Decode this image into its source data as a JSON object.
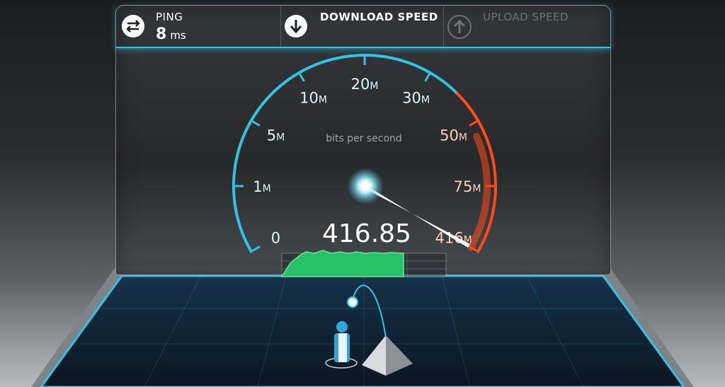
{
  "ping": {
    "label": "PING",
    "value": "8",
    "unit": "ms"
  },
  "download": {
    "label": "DOWNLOAD SPEED",
    "icon": "arrow-down-icon"
  },
  "upload": {
    "label": "UPLOAD SPEED",
    "icon": "arrow-up-icon"
  },
  "ping_icon": "swap-arrows-icon",
  "gauge": {
    "unit_label": "bits per second",
    "ticks": [
      {
        "num": "0",
        "unit": ""
      },
      {
        "num": "1",
        "unit": "M"
      },
      {
        "num": "5",
        "unit": "M"
      },
      {
        "num": "10",
        "unit": "M"
      },
      {
        "num": "20",
        "unit": "M"
      },
      {
        "num": "30",
        "unit": "M"
      },
      {
        "num": "50",
        "unit": "M"
      },
      {
        "num": "75",
        "unit": "M"
      },
      {
        "num": "416",
        "unit": "M"
      }
    ],
    "reading": "416.85"
  },
  "colors": {
    "accent": "#2fc4e4",
    "hot": "#ff4a1c",
    "graph": "#27c267",
    "muted": "#6c7276"
  }
}
